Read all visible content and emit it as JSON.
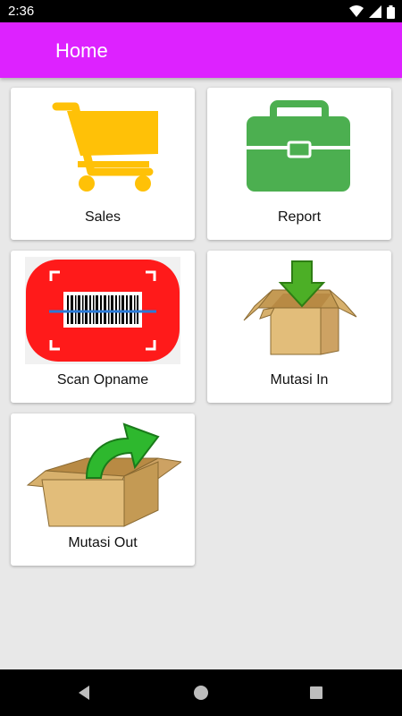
{
  "status_bar": {
    "time": "2:36",
    "icons": [
      "wifi-icon",
      "signal-icon",
      "battery-icon"
    ]
  },
  "app_bar": {
    "title": "Home",
    "color": "#dd22ff"
  },
  "menu": {
    "items": [
      {
        "label": "Sales",
        "icon": "shopping-cart-icon"
      },
      {
        "label": "Report",
        "icon": "briefcase-icon"
      },
      {
        "label": "Scan Opname",
        "icon": "barcode-scan-icon"
      },
      {
        "label": "Mutasi In",
        "icon": "box-download-icon"
      },
      {
        "label": "Mutasi Out",
        "icon": "box-upload-icon"
      }
    ]
  },
  "nav_bar": {
    "buttons": [
      "back-icon",
      "home-icon",
      "recents-icon"
    ]
  }
}
